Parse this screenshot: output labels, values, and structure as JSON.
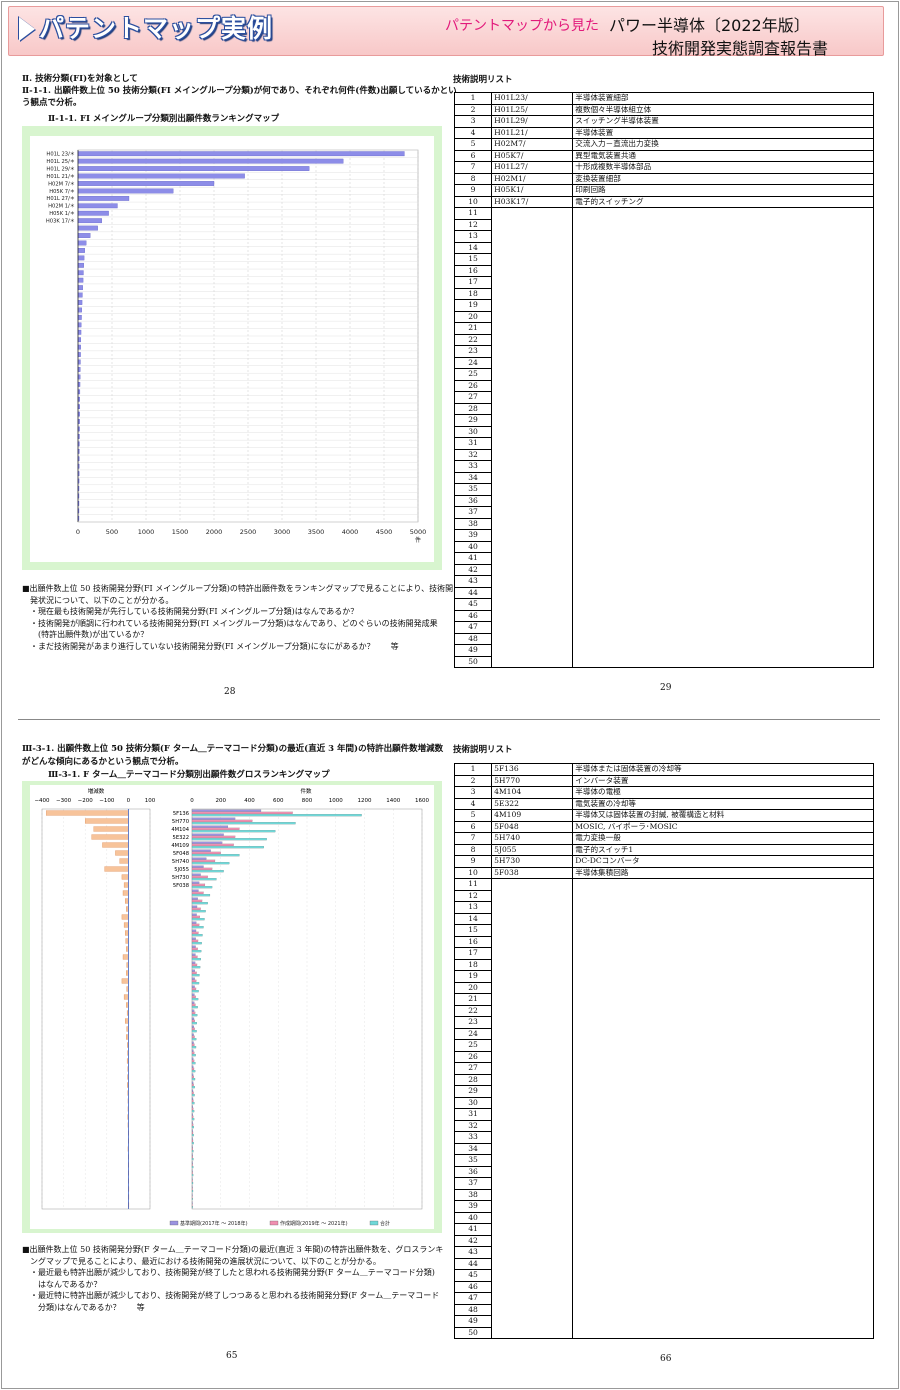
{
  "header": {
    "title": "パテントマップ実例",
    "subtitle": "パテントマップから見た",
    "product": "パワー半導体〔2022年版〕",
    "report": "技術開発実態調査報告書"
  },
  "section1": {
    "heading1": "Ⅱ. 技術分類(FI)を対象として",
    "heading2a": "Ⅱ-1-1. 出願件数上位 50 技術分類(FI メイングループ分類)が何であり、それぞれ何件(件数)出願しているかとい",
    "heading2b": "う観点で分析。",
    "chart_title": "Ⅱ-1-1. FI メイングループ分類別出願件数ランキングマップ",
    "notes": [
      "■出願件数上位 50 技術開発分野(FI メイングループ分類)の特許出願件数をランキングマップで見ることにより、技術開",
      "　発状況について、以下のことが分かる。",
      "　・現在最も技術開発が先行している技術開発分野(FI メイングループ分類)はなんであるか？",
      "　・技術開発が順調に行われている技術開発分野(FI メイングループ分類)はなんであり、どのぐらいの技術開発成果",
      "　　(特許出願件数)が出ているか？",
      "　・まだ技術開発があまり進行していない技術開発分野(FI メイングループ分類)になにがあるか？　　等"
    ],
    "page_left": "28",
    "page_right": "29",
    "list_title": "技術説明リスト"
  },
  "section2": {
    "heading1a": "Ⅲ-3-1. 出願件数上位 50 技術分類(F ターム＿テーマコード分類)の最近(直近 3 年間)の特許出願件数増減数",
    "heading1b": "がどんな傾向にあるかという観点で分析。",
    "chart_title": "Ⅲ-3-1. F ターム＿テーマコード分類別出願件数グロスランキングマップ",
    "notes": [
      "■出願件数上位 50 技術開発分野(F ターム＿テーマコード分類)の最近(直近 3 年間)の特許出願件数を、グロスランキ",
      "　ングマップで見ることにより、最近における技術開発の進展状況について、以下のことが分かる。",
      "　・最近最も特許出願が減少しており、技術開発が終了したと思われる技術開発分野(F ターム＿テーマコード分類)",
      "　　はなんであるか？",
      "　・最近特に特許出願が減少しており、技術開発が終了しつつあると思われる技術開発分野(F ターム＿テーマコード",
      "　　分類)はなんであるか？　　等"
    ],
    "page_left": "65",
    "page_right": "66",
    "list_title": "技術説明リスト"
  },
  "chart_data": [
    {
      "type": "bar",
      "title": "Ⅱ-1-1. FI メイングループ分類別出願件数ランキングマップ",
      "orientation": "horizontal",
      "categories": [
        "H01L 23/＊",
        "H01L 25/＊",
        "H01L 29/＊",
        "H01L 21/＊",
        "H02M 7/＊",
        "H05K 7/＊",
        "H01L 27/＊",
        "H02M 1/＊",
        "H05K 1/＊",
        "H03K 17/＊"
      ],
      "values": [
        4800,
        3900,
        3400,
        2450,
        2000,
        1400,
        750,
        580,
        450,
        350,
        290,
        180,
        120,
        100,
        90,
        85,
        80,
        75,
        70,
        65,
        60,
        56,
        52,
        48,
        45,
        42,
        40,
        38,
        36,
        34,
        32,
        30,
        28,
        27,
        26,
        25,
        24,
        23,
        22,
        21,
        20,
        19,
        18,
        17,
        16,
        15,
        14,
        13,
        12,
        11
      ],
      "xlim": [
        0,
        5000
      ],
      "xticks": [
        "0",
        "500",
        "1000",
        "1500",
        "2000",
        "2500",
        "3000",
        "3500",
        "4000",
        "4500",
        "5000"
      ],
      "xlabel": "件",
      "grid": true
    },
    {
      "type": "bar",
      "title": "Ⅲ-3-1. F ターム＿テーマコード分類別出願件数グロスランキングマップ",
      "orientation": "horizontal",
      "categories": [
        "5F136",
        "5H770",
        "4M104",
        "5E322",
        "4M109",
        "5F048",
        "5H740",
        "5J055",
        "5H730",
        "5F038"
      ],
      "diff_label": "増減数",
      "diff_xlim": [
        -400,
        100
      ],
      "diff_xticks": [
        "−400",
        "−300",
        "−200",
        "−100",
        "0",
        "100"
      ],
      "diff_values": [
        -380,
        -200,
        -160,
        -170,
        -120,
        -60,
        -40,
        -110,
        -30,
        -20,
        -25,
        -15,
        -10,
        -30,
        -20,
        -15,
        -12,
        -10,
        -25,
        -8,
        -10,
        -30,
        -8,
        -20,
        -10,
        -6,
        -15,
        -8,
        -10,
        -5,
        -4,
        -6,
        -3,
        -4,
        -5,
        -3,
        -2,
        -2,
        -3,
        -2,
        -1,
        -1,
        -2,
        -1,
        -1,
        -1,
        -1,
        0,
        0,
        0
      ],
      "count_label": "件数",
      "count_xlim": [
        0,
        1600
      ],
      "count_xticks": [
        "0",
        "200",
        "400",
        "600",
        "800",
        "1000",
        "1200",
        "1400",
        "1600"
      ],
      "series": [
        {
          "name": "基準期間(2017年 ～ 2018年)",
          "color": "#9b93e0",
          "values": [
            480,
            300,
            250,
            220,
            210,
            130,
            100,
            80,
            60,
            50,
            45,
            40,
            35,
            32,
            30,
            28,
            26,
            25,
            24,
            22,
            20,
            19,
            18,
            17,
            16,
            15,
            14,
            13,
            12,
            11,
            10,
            9,
            9,
            8,
            8,
            7,
            7,
            6,
            6,
            5,
            5,
            5,
            4,
            4,
            4,
            3,
            3,
            3,
            2,
            2
          ]
        },
        {
          "name": "作成期間(2019年 ～ 2021年)",
          "color": "#f08fb0",
          "values": [
            700,
            420,
            330,
            300,
            290,
            200,
            160,
            140,
            110,
            90,
            80,
            70,
            60,
            55,
            50,
            45,
            42,
            40,
            38,
            35,
            32,
            30,
            28,
            26,
            24,
            22,
            20,
            19,
            18,
            17,
            16,
            15,
            14,
            13,
            12,
            11,
            10,
            9,
            9,
            8,
            7,
            7,
            6,
            6,
            5,
            5,
            4,
            4,
            3,
            3
          ]
        },
        {
          "name": "合計",
          "color": "#6fd8d8",
          "values": [
            1180,
            720,
            580,
            520,
            500,
            330,
            260,
            220,
            170,
            140,
            125,
            110,
            95,
            87,
            80,
            73,
            68,
            65,
            62,
            57,
            52,
            49,
            46,
            43,
            40,
            37,
            34,
            32,
            30,
            28,
            26,
            24,
            23,
            21,
            20,
            18,
            17,
            15,
            15,
            13,
            12,
            12,
            10,
            10,
            9,
            8,
            7,
            7,
            5,
            5
          ]
        }
      ],
      "grid": true
    }
  ],
  "list1": [
    {
      "n": "1",
      "code": "H01L23/",
      "desc": "半導体装置細部"
    },
    {
      "n": "2",
      "code": "H01L25/",
      "desc": "複数個々半導体組立体"
    },
    {
      "n": "3",
      "code": "H01L29/",
      "desc": "スイッチング半導体装置"
    },
    {
      "n": "4",
      "code": "H01L21/",
      "desc": "半導体装置"
    },
    {
      "n": "5",
      "code": "H02M7/",
      "desc": "交流入力－直流出力変換"
    },
    {
      "n": "6",
      "code": "H05K7/",
      "desc": "異型電気装置共通"
    },
    {
      "n": "7",
      "code": "H01L27/",
      "desc": "十形成複数半導体部品"
    },
    {
      "n": "8",
      "code": "H02M1/",
      "desc": "変換装置細部"
    },
    {
      "n": "9",
      "code": "H05K1/",
      "desc": "印刷回路"
    },
    {
      "n": "10",
      "code": "H03K17/",
      "desc": "電子的スイッチング"
    }
  ],
  "list2": [
    {
      "n": "1",
      "code": "5F136",
      "desc": "半導体または固体装置の冷却等"
    },
    {
      "n": "2",
      "code": "5H770",
      "desc": "インバータ装置"
    },
    {
      "n": "3",
      "code": "4M104",
      "desc": "半導体の電極"
    },
    {
      "n": "4",
      "code": "5E322",
      "desc": "電気装置の冷却等"
    },
    {
      "n": "5",
      "code": "4M109",
      "desc": "半導体又は固体装置の封緘, 被覆構造と材料"
    },
    {
      "n": "6",
      "code": "5F048",
      "desc": "MOSIC, バイポーラ･MOSIC"
    },
    {
      "n": "7",
      "code": "5H740",
      "desc": "電力変換一般"
    },
    {
      "n": "8",
      "code": "5J055",
      "desc": "電子的スイッチ1"
    },
    {
      "n": "9",
      "code": "5H730",
      "desc": "DC-DCコンバータ"
    },
    {
      "n": "10",
      "code": "5F038",
      "desc": "半導体集積回路"
    }
  ],
  "empty_rows": [
    "11",
    "12",
    "13",
    "14",
    "15",
    "16",
    "17",
    "18",
    "19",
    "20",
    "21",
    "22",
    "23",
    "24",
    "25",
    "26",
    "27",
    "28",
    "29",
    "30",
    "31",
    "32",
    "33",
    "34",
    "35",
    "36",
    "37",
    "38",
    "39",
    "40",
    "41",
    "42",
    "43",
    "44",
    "45",
    "46",
    "47",
    "48",
    "49",
    "50"
  ]
}
